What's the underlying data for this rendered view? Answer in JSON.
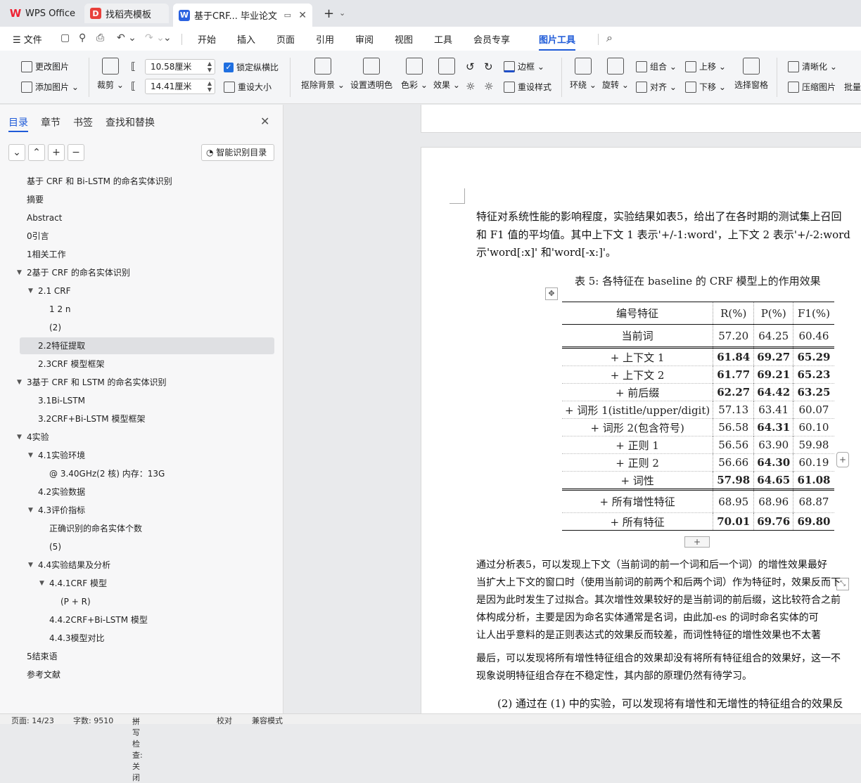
{
  "titlebar": {
    "tabs": [
      {
        "label": "WPS Office"
      },
      {
        "label": "找稻壳模板"
      },
      {
        "label": "基于CRF... 毕业论文"
      }
    ],
    "new_tab": "+",
    "new_tab_dropdown": "⌄"
  },
  "menu": {
    "file": "文件",
    "items": [
      "开始",
      "插入",
      "页面",
      "引用",
      "审阅",
      "视图",
      "工具",
      "会员专享",
      "图片工具"
    ],
    "active": "图片工具"
  },
  "ribbon": {
    "change_picture": "更改图片",
    "add_picture": "添加图片",
    "crop": "裁剪",
    "width_value": "10.58厘米",
    "height_value": "14.41厘米",
    "lock_ratio": "锁定纵横比",
    "reset_size": "重设大小",
    "remove_bg": "抠除背景",
    "set_transparent": "设置透明色",
    "color": "色彩",
    "effect": "效果",
    "border": "边框",
    "reset_style": "重设样式",
    "wrap": "环绕",
    "rotate": "旋转",
    "group": "组合",
    "align": "对齐",
    "bring_forward": "上移",
    "send_backward": "下移",
    "selection_pane": "选择窗格",
    "sharpen": "清晰化",
    "compress": "压缩图片",
    "batch": "批量"
  },
  "sidebar": {
    "tabs": [
      "目录",
      "章节",
      "书签",
      "查找和替换"
    ],
    "smart_button": "智能识别目录",
    "toc": [
      {
        "label": "基于 CRF 和 Bi-LSTM 的命名实体识别",
        "level": 0
      },
      {
        "label": "摘要",
        "level": 0
      },
      {
        "label": "Abstract",
        "level": 0
      },
      {
        "label": "0引言",
        "level": 0
      },
      {
        "label": "1相关工作",
        "level": 0
      },
      {
        "label": "2基于 CRF 的命名实体识别",
        "level": 0,
        "expanded": true
      },
      {
        "label": "2.1 CRF",
        "level": 1,
        "expanded": true
      },
      {
        "label": "1 2 n",
        "level": 2
      },
      {
        "label": "(2)",
        "level": 2
      },
      {
        "label": "2.2特征提取",
        "level": 1,
        "selected": true
      },
      {
        "label": "2.3CRF 模型框架",
        "level": 1
      },
      {
        "label": "3基于 CRF 和 LSTM 的命名实体识别",
        "level": 0,
        "expanded": true
      },
      {
        "label": "3.1Bi-LSTM",
        "level": 1
      },
      {
        "label": "3.2CRF+Bi-LSTM 模型框架",
        "level": 1
      },
      {
        "label": "4实验",
        "level": 0,
        "expanded": true
      },
      {
        "label": "4.1实验环境",
        "level": 1,
        "expanded": true
      },
      {
        "label": "@ 3.40GHz(2 核) 内存：13G",
        "level": 2
      },
      {
        "label": "4.2实验数据",
        "level": 1
      },
      {
        "label": "4.3评价指标",
        "level": 1,
        "expanded": true
      },
      {
        "label": "正确识别的命名实体个数",
        "level": 2
      },
      {
        "label": "(5)",
        "level": 2
      },
      {
        "label": "4.4实验结果及分析",
        "level": 1,
        "expanded": true
      },
      {
        "label": "4.4.1CRF 模型",
        "level": 2,
        "expanded": true
      },
      {
        "label": "(P + R)",
        "level": 3
      },
      {
        "label": "4.4.2CRF+Bi-LSTM 模型",
        "level": 2
      },
      {
        "label": "4.4.3模型对比",
        "level": 2
      },
      {
        "label": "5结束语",
        "level": 0
      },
      {
        "label": "参考文献",
        "level": 0
      }
    ]
  },
  "document": {
    "para1": [
      "特征对系统性能的影响程度，实验结果如表5，给出了在各时期的测试集上召回",
      "和  F1 值的平均值。其中上下文  1 表示'+/-1:word'，上下文  2 表示'+/-2:word",
      "示'word[:x]' 和'word[-x:]'。"
    ],
    "table_caption": "表 5: 各特征在  baseline 的 CRF 模型上的作用效果",
    "table": {
      "headers": [
        "编号特征",
        "R(%)",
        "P(%)",
        "F1(%)"
      ],
      "rows": [
        {
          "cells": [
            "当前词",
            "57.20",
            "64.25",
            "60.46"
          ],
          "bold": [
            false,
            false,
            false
          ]
        },
        {
          "cells": [
            "+ 上下文  1",
            "61.84",
            "69.27",
            "65.29"
          ],
          "bold": [
            true,
            true,
            true
          ]
        },
        {
          "cells": [
            "+ 上下文  2",
            "61.77",
            "69.21",
            "65.23"
          ],
          "bold": [
            true,
            true,
            true
          ]
        },
        {
          "cells": [
            "+ 前后缀",
            "62.27",
            "64.42",
            "63.25"
          ],
          "bold": [
            true,
            true,
            true
          ]
        },
        {
          "cells": [
            "+ 词形  1(istitle/upper/digit)",
            "57.13",
            "63.41",
            "60.07"
          ],
          "bold": [
            false,
            false,
            false
          ]
        },
        {
          "cells": [
            "+ 词形  2(包含符号)",
            "56.58",
            "64.31",
            "60.10"
          ],
          "bold": [
            false,
            true,
            false
          ]
        },
        {
          "cells": [
            "+ 正则  1",
            "56.56",
            "63.90",
            "59.98"
          ],
          "bold": [
            false,
            false,
            false
          ]
        },
        {
          "cells": [
            "+ 正则  2",
            "56.66",
            "64.30",
            "60.19"
          ],
          "bold": [
            false,
            true,
            false
          ]
        },
        {
          "cells": [
            "+ 词性",
            "57.98",
            "64.65",
            "61.08"
          ],
          "bold": [
            true,
            true,
            true
          ]
        },
        {
          "cells": [
            "+ 所有增性特征",
            "68.95",
            "68.96",
            "68.87"
          ],
          "bold": [
            false,
            false,
            false
          ]
        },
        {
          "cells": [
            "+ 所有特征",
            "70.01",
            "69.76",
            "69.80"
          ],
          "bold": [
            true,
            true,
            true
          ]
        }
      ]
    },
    "para2": [
      "通过分析表5，可以发现上下文（当前词的前一个词和后一个词）的增性效果最好",
      "当扩大上下文的窗口时（使用当前词的前两个和后两个词）作为特征时，效果反而下",
      "是因为此时发生了过拟合。其次增性效果较好的是当前词的前后缀，这比较符合之前",
      "体构成分析，主要是因为命名实体通常是名词，由此加-es 的词时命名实体的可",
      "让人出乎意料的是正则表达式的效果反而较差，而词性特征的增性效果也不太著"
    ],
    "para3": [
      "最后，可以发现将所有增性特征组合的效果却没有将所有特征组合的效果好，这一不",
      "现象说明特征组合存在不稳定性，其内部的原理仍然有待学习。"
    ],
    "para4": "(2)  通过在  (1) 中的实验，可以发现将有增性和无增性的特征组合的效果反"
  },
  "status": {
    "page": "页面: 14/23",
    "words": "字数: 9510",
    "spell": "拼写检查: 关闭",
    "proof": "校对",
    "compat": "兼容模式"
  }
}
